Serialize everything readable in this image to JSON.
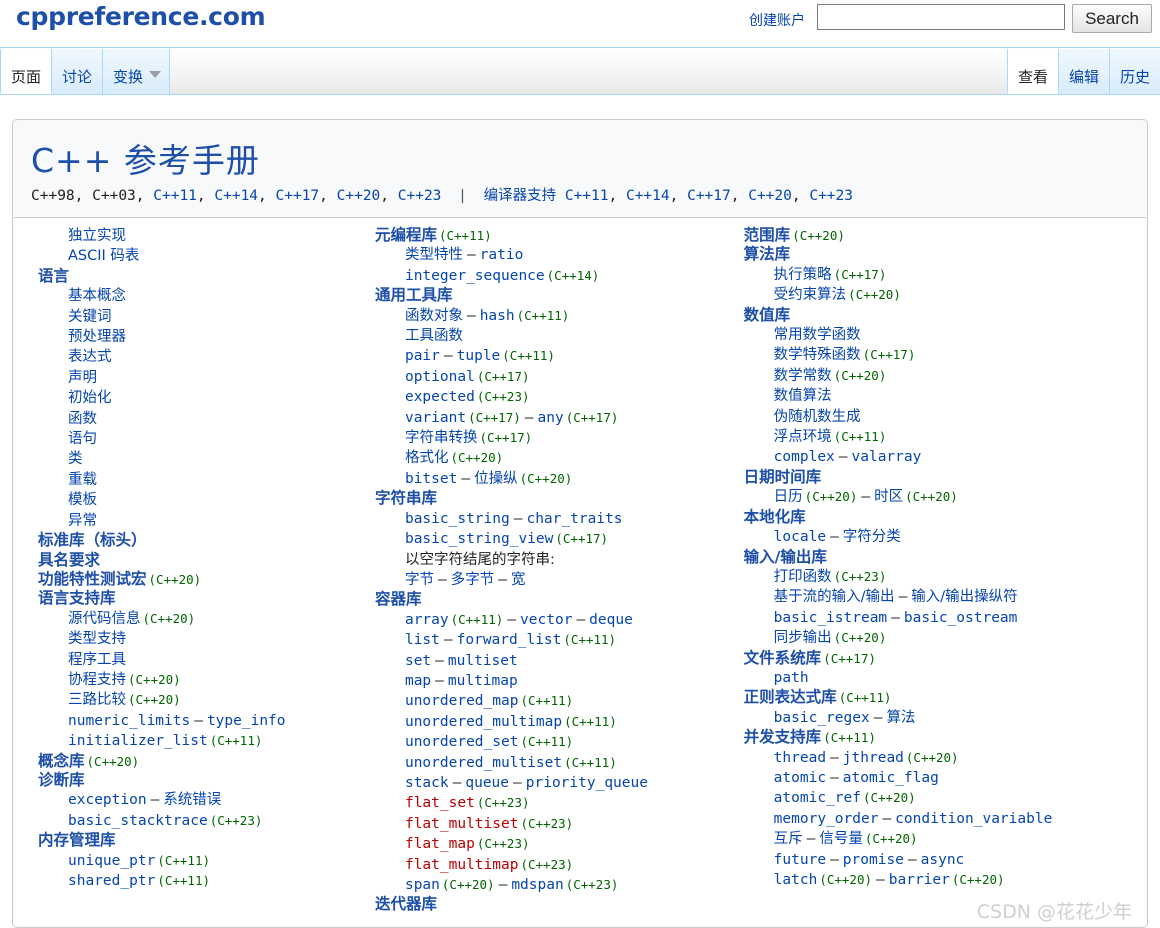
{
  "header": {
    "logo": "cppreference.com",
    "create_account": "创建账户",
    "search_value": "",
    "search_placeholder": "",
    "search_button": "Search"
  },
  "tabs": {
    "left": [
      {
        "label": "页面",
        "selected": true
      },
      {
        "label": "讨论",
        "selected": false
      },
      {
        "label": "变换",
        "selected": false,
        "dropdown": true
      }
    ],
    "right": [
      {
        "label": "查看",
        "selected": true
      },
      {
        "label": "编辑",
        "selected": false
      },
      {
        "label": "历史",
        "selected": false
      }
    ]
  },
  "title": {
    "heading": "C++ 参考手册",
    "standards": [
      "C++98",
      "C++03",
      "C++11",
      "C++14",
      "C++17",
      "C++20",
      "C++23"
    ],
    "standards_plain_count": 2,
    "separator": "|",
    "compiler_support_label": "编译器支持",
    "compiler_support_versions": [
      "C++11",
      "C++14",
      "C++17",
      "C++20",
      "C++23"
    ]
  },
  "watermark": "CSDN @花花少年",
  "colors": {
    "link": "#0645ad",
    "heading": "#1d4fa8",
    "version": "#006400",
    "broken_link": "#ba0000",
    "tab_border": "#a7d7f9"
  },
  "columns": [
    {
      "id": "column-1",
      "blocks": [
        {
          "type": "items",
          "items": [
            {
              "text": "独立实现",
              "style": "itm"
            },
            {
              "text": "ASCII 码表",
              "style": "itm"
            }
          ]
        },
        {
          "type": "heading",
          "text": "语言",
          "items": [
            {
              "text": "基本概念",
              "style": "itm"
            },
            {
              "text": "关键词",
              "style": "itm"
            },
            {
              "text": "预处理器",
              "style": "itm"
            },
            {
              "text": "表达式",
              "style": "itm"
            },
            {
              "text": "声明",
              "style": "itm"
            },
            {
              "text": "初始化",
              "style": "itm"
            },
            {
              "text": "函数",
              "style": "itm"
            },
            {
              "text": "语句",
              "style": "itm"
            },
            {
              "text": "类",
              "style": "itm"
            },
            {
              "text": "重载",
              "style": "itm"
            },
            {
              "text": "模板",
              "style": "itm"
            },
            {
              "text": "异常",
              "style": "itm"
            }
          ]
        },
        {
          "type": "heading",
          "text": "标准库（标头）",
          "items": []
        },
        {
          "type": "heading",
          "text": "具名要求",
          "items": []
        },
        {
          "type": "heading",
          "text": "功能特性测试宏",
          "ver": "(C++20)",
          "items": []
        },
        {
          "type": "heading",
          "text": "语言支持库",
          "items": [
            {
              "text": "源代码信息",
              "style": "itm",
              "ver": "(C++20)"
            },
            {
              "text": "类型支持",
              "style": "itm"
            },
            {
              "text": "程序工具",
              "style": "itm"
            },
            {
              "text": "协程支持",
              "style": "itm",
              "ver": "(C++20)"
            },
            {
              "text": "三路比较",
              "style": "itm",
              "ver": "(C++20)"
            },
            {
              "text": "numeric_limits",
              "style": "mono",
              "dash": "—",
              "text2": "type_info",
              "style2": "mono"
            },
            {
              "text": "initializer_list",
              "style": "mono",
              "ver": "(C++11)"
            }
          ]
        },
        {
          "type": "heading",
          "text": "概念库",
          "ver": "(C++20)",
          "items": []
        },
        {
          "type": "heading",
          "text": "诊断库",
          "items": [
            {
              "text": "exception",
              "style": "mono",
              "dash": "—",
              "text2": "系统错误",
              "style2": "itm"
            },
            {
              "text": "basic_stacktrace",
              "style": "mono",
              "ver": "(C++23)"
            }
          ]
        },
        {
          "type": "heading",
          "text": "内存管理库",
          "items": [
            {
              "text": "unique_ptr",
              "style": "mono",
              "ver": "(C++11)"
            },
            {
              "text": "shared_ptr",
              "style": "mono",
              "ver": "(C++11)"
            }
          ]
        }
      ]
    },
    {
      "id": "column-2",
      "blocks": [
        {
          "type": "heading",
          "text": "元编程库",
          "ver": "(C++11)",
          "items": [
            {
              "text": "类型特性",
              "style": "itm",
              "dash": "—",
              "text2": "ratio",
              "style2": "mono"
            },
            {
              "text": "integer_sequence",
              "style": "mono",
              "ver": "(C++14)"
            }
          ]
        },
        {
          "type": "heading",
          "text": "通用工具库",
          "items": [
            {
              "text": "函数对象",
              "style": "itm",
              "dash": "—",
              "text2": "hash",
              "style2": "mono",
              "ver2": "(C++11)"
            },
            {
              "text": "工具函数",
              "style": "itm"
            },
            {
              "text": "pair",
              "style": "mono",
              "dash": "—",
              "text2": "tuple",
              "style2": "mono",
              "ver2": "(C++11)"
            },
            {
              "text": "optional",
              "style": "mono",
              "ver": "(C++17)"
            },
            {
              "text": "expected",
              "style": "mono",
              "ver": "(C++23)"
            },
            {
              "text": "variant",
              "style": "mono",
              "ver": "(C++17)",
              "dash": "—",
              "text2": "any",
              "style2": "mono",
              "ver2": "(C++17)"
            },
            {
              "text": "字符串转换",
              "style": "itm",
              "ver": "(C++17)"
            },
            {
              "text": "格式化",
              "style": "itm",
              "ver": "(C++20)"
            },
            {
              "text": "bitset",
              "style": "mono",
              "dash": "—",
              "text2": "位操纵",
              "style2": "itm",
              "ver2": "(C++20)"
            }
          ]
        },
        {
          "type": "heading",
          "text": "字符串库",
          "items": [
            {
              "text": "basic_string",
              "style": "mono",
              "dash": "—",
              "text2": "char_traits",
              "style2": "mono"
            },
            {
              "text": "basic_string_view",
              "style": "mono",
              "ver": "(C++17)"
            },
            {
              "text": "以空字符结尾的字符串:",
              "style": "plain"
            },
            {
              "text": "字节",
              "style": "itm",
              "indent": true,
              "dash": "—",
              "text2": "多字节",
              "style2": "itm",
              "dash2": "—",
              "text3": "宽",
              "style3": "itm"
            }
          ]
        },
        {
          "type": "heading",
          "text": "容器库",
          "items": [
            {
              "text": "array",
              "style": "mono",
              "ver": "(C++11)",
              "dash": "—",
              "text2": "vector",
              "style2": "mono",
              "dash2": "—",
              "text3": "deque",
              "style3": "mono"
            },
            {
              "text": "list",
              "style": "mono",
              "dash": "—",
              "text2": "forward_list",
              "style2": "mono",
              "ver2": "(C++11)"
            },
            {
              "text": "set",
              "style": "mono",
              "dash": "—",
              "text2": "multiset",
              "style2": "mono"
            },
            {
              "text": "map",
              "style": "mono",
              "dash": "—",
              "text2": "multimap",
              "style2": "mono"
            },
            {
              "text": "unordered_map",
              "style": "mono",
              "ver": "(C++11)"
            },
            {
              "text": "unordered_multimap",
              "style": "mono",
              "ver": "(C++11)"
            },
            {
              "text": "unordered_set",
              "style": "mono",
              "ver": "(C++11)"
            },
            {
              "text": "unordered_multiset",
              "style": "mono",
              "ver": "(C++11)"
            },
            {
              "text": "stack",
              "style": "mono",
              "dash": "—",
              "text2": "queue",
              "style2": "mono",
              "dash2": "—",
              "text3": "priority_queue",
              "style3": "mono"
            },
            {
              "text": "flat_set",
              "style": "mono broken",
              "ver": "(C++23)"
            },
            {
              "text": "flat_multiset",
              "style": "mono broken",
              "ver": "(C++23)"
            },
            {
              "text": "flat_map",
              "style": "mono broken",
              "ver": "(C++23)"
            },
            {
              "text": "flat_multimap",
              "style": "mono broken",
              "ver": "(C++23)"
            },
            {
              "text": "span",
              "style": "mono",
              "ver": "(C++20)",
              "dash": "—",
              "text2": "mdspan",
              "style2": "mono",
              "ver2": "(C++23)"
            }
          ]
        },
        {
          "type": "heading",
          "text": "迭代器库",
          "items": []
        }
      ]
    },
    {
      "id": "column-3",
      "blocks": [
        {
          "type": "heading",
          "text": "范围库",
          "ver": "(C++20)",
          "items": []
        },
        {
          "type": "heading",
          "text": "算法库",
          "items": [
            {
              "text": "执行策略",
              "style": "itm",
              "ver": "(C++17)"
            },
            {
              "text": "受约束算法",
              "style": "itm",
              "ver": "(C++20)"
            }
          ]
        },
        {
          "type": "heading",
          "text": "数值库",
          "items": [
            {
              "text": "常用数学函数",
              "style": "itm"
            },
            {
              "text": "数学特殊函数",
              "style": "itm",
              "ver": "(C++17)"
            },
            {
              "text": "数学常数",
              "style": "itm",
              "ver": "(C++20)"
            },
            {
              "text": "数值算法",
              "style": "itm"
            },
            {
              "text": "伪随机数生成",
              "style": "itm"
            },
            {
              "text": "浮点环境",
              "style": "itm",
              "ver": "(C++11)"
            },
            {
              "text": "complex",
              "style": "mono",
              "dash": "—",
              "text2": "valarray",
              "style2": "mono"
            }
          ]
        },
        {
          "type": "heading",
          "text": "日期时间库",
          "items": [
            {
              "text": "日历",
              "style": "itm",
              "ver": "(C++20)",
              "dash": "—",
              "text2": "时区",
              "style2": "itm",
              "ver2": "(C++20)"
            }
          ]
        },
        {
          "type": "heading",
          "text": "本地化库",
          "items": [
            {
              "text": "locale",
              "style": "mono",
              "dash": "—",
              "text2": "字符分类",
              "style2": "itm"
            }
          ]
        },
        {
          "type": "heading",
          "text": "输入/输出库",
          "items": [
            {
              "text": "打印函数",
              "style": "itm",
              "ver": "(C++23)"
            },
            {
              "text": "基于流的输入/输出",
              "style": "itm",
              "dash": "—",
              "text2": "输入/输出操纵符",
              "style2": "itm"
            },
            {
              "text": "basic_istream",
              "style": "mono",
              "dash": "—",
              "text2": "basic_ostream",
              "style2": "mono"
            },
            {
              "text": "同步输出",
              "style": "itm",
              "ver": "(C++20)"
            }
          ]
        },
        {
          "type": "heading",
          "text": "文件系统库",
          "ver": "(C++17)",
          "items": [
            {
              "text": "path",
              "style": "mono"
            }
          ]
        },
        {
          "type": "heading",
          "text": "正则表达式库",
          "ver": "(C++11)",
          "items": [
            {
              "text": "basic_regex",
              "style": "mono",
              "dash": "—",
              "text2": "算法",
              "style2": "itm"
            }
          ]
        },
        {
          "type": "heading",
          "text": "并发支持库",
          "ver": "(C++11)",
          "items": [
            {
              "text": "thread",
              "style": "mono",
              "dash": "—",
              "text2": "jthread",
              "style2": "mono",
              "ver2": "(C++20)"
            },
            {
              "text": "atomic",
              "style": "mono",
              "dash": "—",
              "text2": "atomic_flag",
              "style2": "mono"
            },
            {
              "text": "atomic_ref",
              "style": "mono",
              "ver": "(C++20)"
            },
            {
              "text": "memory_order",
              "style": "mono",
              "dash": "—",
              "text2": "condition_variable",
              "style2": "mono"
            },
            {
              "text": "互斥",
              "style": "itm",
              "dash": "—",
              "text2": "信号量",
              "style2": "itm",
              "ver2": "(C++20)"
            },
            {
              "text": "future",
              "style": "mono",
              "dash": "—",
              "text2": "promise",
              "style2": "mono",
              "dash2": "—",
              "text3": "async",
              "style3": "mono"
            },
            {
              "text": "latch",
              "style": "mono",
              "ver": "(C++20)",
              "dash": "—",
              "text2": "barrier",
              "style2": "mono",
              "ver2": "(C++20)"
            }
          ]
        }
      ]
    }
  ]
}
